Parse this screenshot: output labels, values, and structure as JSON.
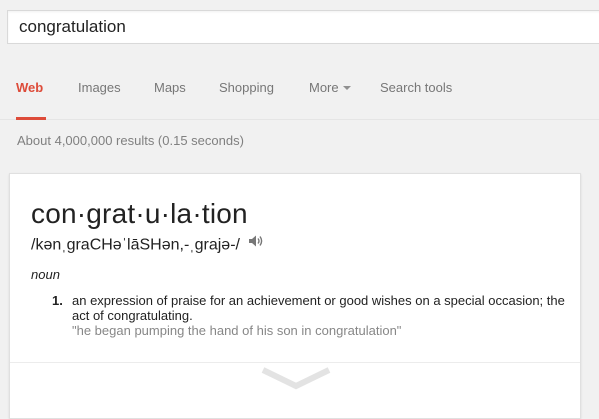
{
  "search": {
    "query": "congratulation"
  },
  "tabs": [
    {
      "label": "Web",
      "active": true
    },
    {
      "label": "Images",
      "active": false
    },
    {
      "label": "Maps",
      "active": false
    },
    {
      "label": "Shopping",
      "active": false
    },
    {
      "label": "More",
      "active": false
    },
    {
      "label": "Search tools",
      "active": false
    }
  ],
  "stats": "About 4,000,000 results (0.15 seconds)",
  "definition": {
    "word": "con·grat·u·la·tion",
    "phonetic": "/kənˌgraCHəˈlāSHən,-ˌgrajə-/",
    "part_of_speech": "noun",
    "sense_number": "1.",
    "sense_text": "an expression of praise for an achievement or good wishes on a special occasion; the act of congratulating.",
    "example": "\"he began pumping the hand of his son in congratulation\""
  },
  "icons": {
    "speaker": "speaker-icon",
    "expand": "chevron-down-icon",
    "more_caret": "caret-down-icon"
  },
  "colors": {
    "accent": "#dd4b39",
    "tab_text": "#777777",
    "stats_text": "#808080",
    "example_text": "#878787",
    "background": "#f1f1f1",
    "card": "#ffffff"
  }
}
